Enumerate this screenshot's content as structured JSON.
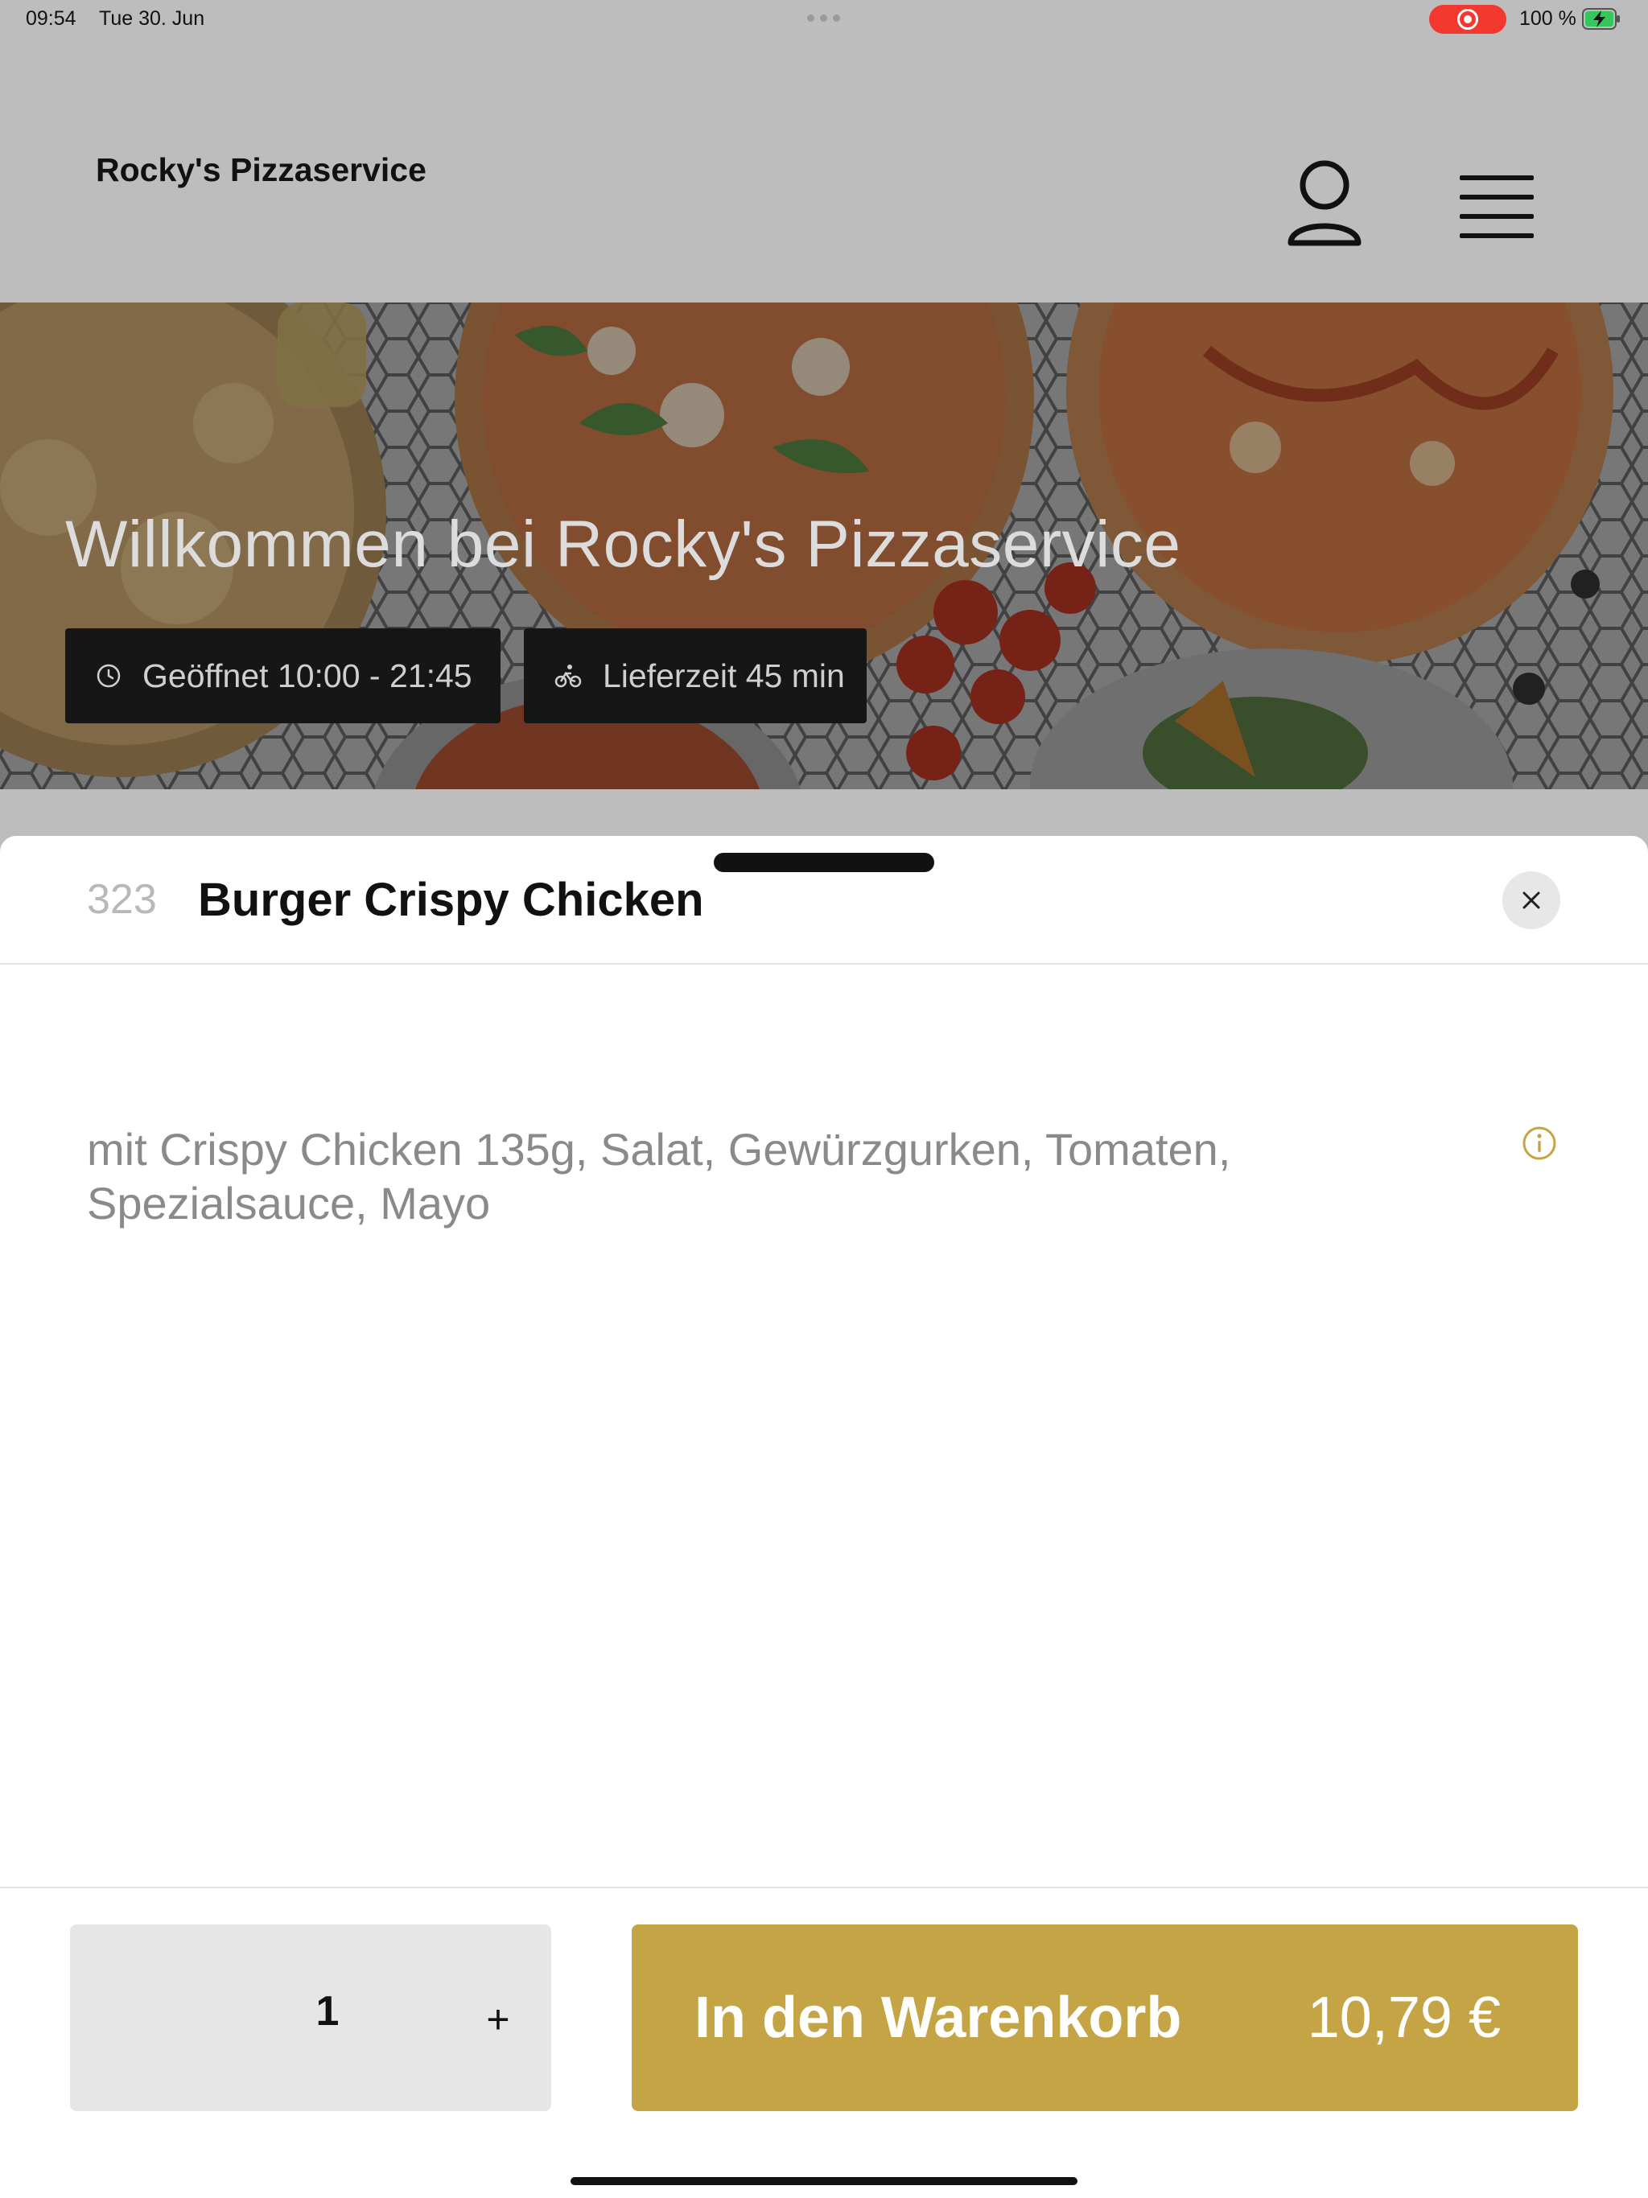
{
  "status_bar": {
    "time": "09:54",
    "date": "Tue 30. Jun",
    "battery_percent": "100 %",
    "icons": [
      "screen-recording-icon",
      "battery-charging-icon"
    ]
  },
  "header": {
    "title": "Rocky's Pizzaservice",
    "icons": [
      "user-icon",
      "menu-icon"
    ]
  },
  "hero": {
    "welcome": "Willkommen bei Rocky's Pizzaservice",
    "opening_hours": "Geöffnet 10:00 - 21:45",
    "delivery_time": "Lieferzeit 45 min",
    "icons": [
      "clock-icon",
      "bicycle-icon"
    ]
  },
  "product": {
    "number": "323",
    "name": "Burger Crispy Chicken",
    "description": "mit Crispy Chicken 135g, Salat, Gewürzgurken, Tomaten, Spezialsauce, Mayo",
    "icons": [
      "close-icon",
      "info-icon"
    ]
  },
  "order": {
    "quantity": "1",
    "increment_label": "+",
    "add_to_cart_label": "In den Warenkorb",
    "price": "10,79 €"
  },
  "colors": {
    "accent": "#c4a445",
    "recording": "#f2382f",
    "dim_overlay": "#bdbdbd"
  }
}
